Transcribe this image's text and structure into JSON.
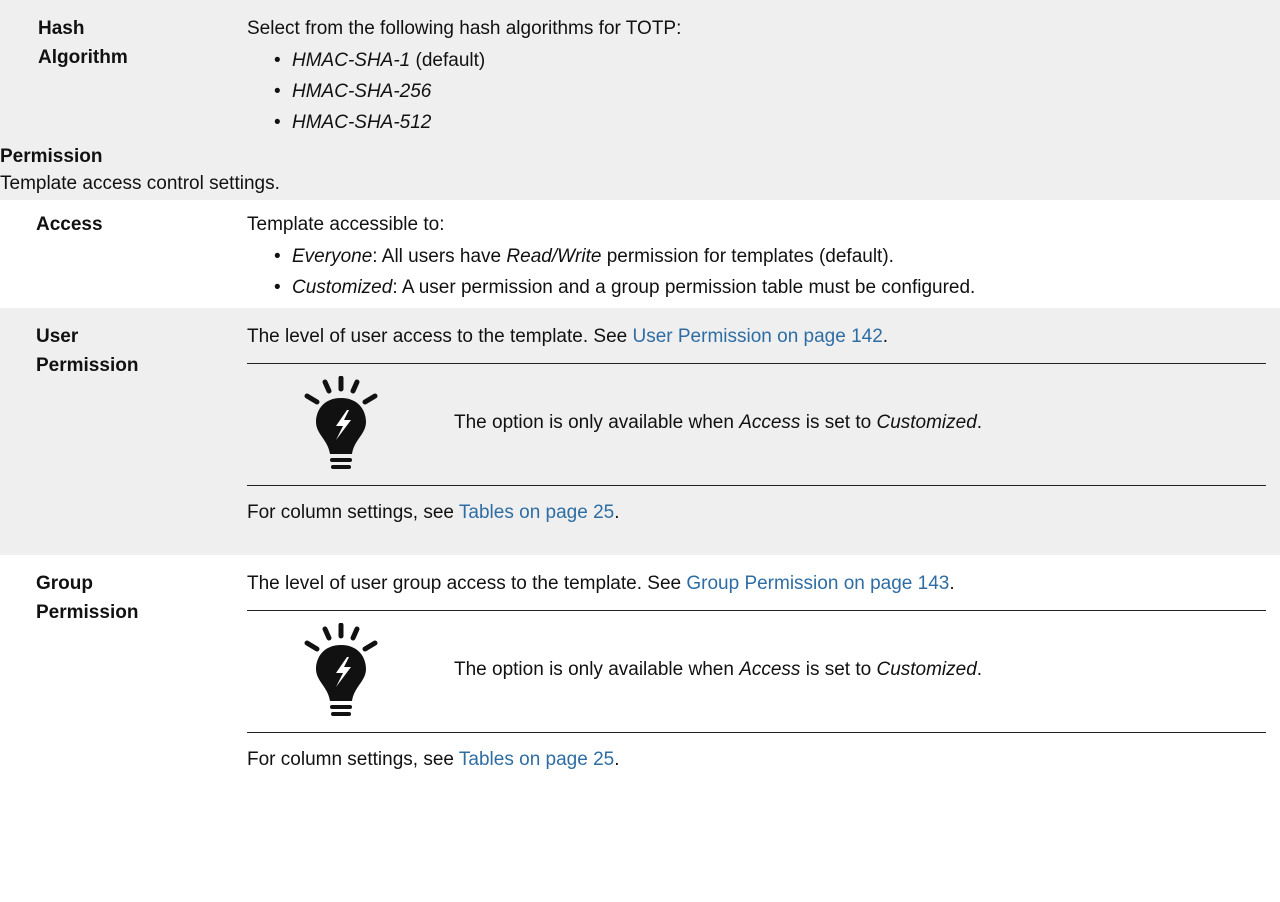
{
  "hash_algorithm": {
    "label": "Hash Algorithm",
    "intro": "Select from the following hash algorithms for TOTP:",
    "options": [
      {
        "name": "HMAC-SHA-1",
        "suffix": " (default)"
      },
      {
        "name": "HMAC-SHA-256",
        "suffix": ""
      },
      {
        "name": "HMAC-SHA-512",
        "suffix": ""
      }
    ]
  },
  "permission": {
    "title": "Permission",
    "description": "Template access control settings."
  },
  "access": {
    "label": "Access",
    "intro": "Template accessible to:",
    "everyone": {
      "term": "Everyone",
      "text_a": ": All users have ",
      "em": "Read/Write",
      "text_b": " permission for templates (default)."
    },
    "customized": {
      "term": "Customized",
      "text": ": A user permission and a group permission table must be configured."
    }
  },
  "user_permission": {
    "label": "User Permission",
    "text": "The level of user access to the template. See ",
    "link": "User Permission on page 142",
    "after_link": ".",
    "note": {
      "a": "The option is only available when ",
      "em1": "Access",
      "b": " is set to ",
      "em2": "Customized",
      "c": "."
    },
    "column_text": "For column settings, see ",
    "column_link": "Tables on page 25",
    "column_after": "."
  },
  "group_permission": {
    "label": "Group Permission",
    "text": "The level of user group access to the template. See ",
    "link": "Group Permission on page 143",
    "after_link": ".",
    "note": {
      "a": "The option is only available when ",
      "em1": "Access",
      "b": " is set to ",
      "em2": "Customized",
      "c": "."
    },
    "column_text": "For column settings, see ",
    "column_link": "Tables on page 25",
    "column_after": "."
  },
  "icons": {
    "note": "lightbulb-tip-icon"
  },
  "colors": {
    "row_grey": "#efefef",
    "link": "#2e6da4",
    "text": "#111111"
  }
}
